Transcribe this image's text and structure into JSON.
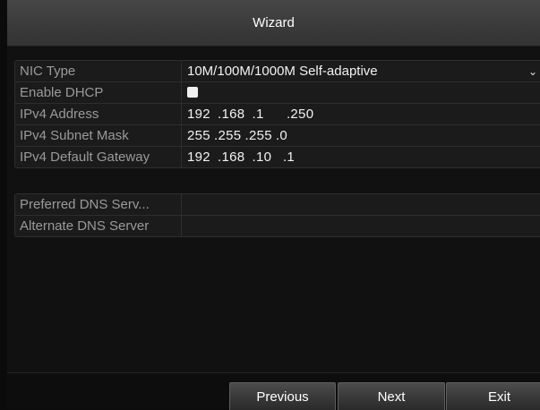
{
  "window": {
    "title": "Wizard"
  },
  "network": {
    "nic_type": {
      "label": "NIC Type",
      "value": "10M/100M/1000M Self-adaptive"
    },
    "dhcp": {
      "label": "Enable DHCP",
      "checked": false
    },
    "ipv4_address": {
      "label": "IPv4 Address",
      "parts": [
        "192",
        "168",
        "1",
        "250"
      ]
    },
    "subnet_mask": {
      "label": "IPv4 Subnet Mask",
      "parts": [
        "255",
        "255",
        "255",
        "0"
      ]
    },
    "default_gateway": {
      "label": "IPv4 Default Gateway",
      "parts": [
        "192",
        "168",
        "10",
        "1"
      ]
    }
  },
  "dns": {
    "preferred": {
      "label": "Preferred DNS Serv...",
      "value": ""
    },
    "alternate": {
      "label": "Alternate DNS Server",
      "value": ""
    }
  },
  "buttons": {
    "previous": "Previous",
    "next": "Next",
    "exit": "Exit"
  }
}
